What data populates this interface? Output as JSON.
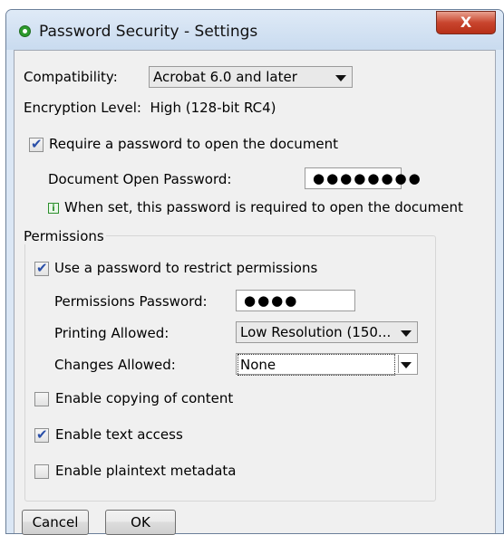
{
  "window": {
    "title": "Password Security - Settings",
    "close_label": "X"
  },
  "compatibility": {
    "label": "Compatibility:",
    "value": "Acrobat 6.0 and later"
  },
  "encryption": {
    "text": "Encryption Level:  High (128-bit RC4)"
  },
  "open_password": {
    "checkbox_label": "Require a password to open the document",
    "checked": true,
    "field_label": "Document Open Password:",
    "field_value": "●●●●●●●●",
    "info_icon": "i",
    "info_text": "When set, this password is required to open the document"
  },
  "permissions": {
    "group_label": "Permissions",
    "checkbox_label": "Use a password to restrict permissions",
    "checked": true,
    "password_label": "Permissions Password:",
    "password_value": "●●●●",
    "printing_label": "Printing Allowed:",
    "printing_value": "Low Resolution (150...",
    "changes_label": "Changes Allowed:",
    "changes_value": "None",
    "options": [
      {
        "label": "Enable copying of content",
        "checked": false
      },
      {
        "label": "Enable text access",
        "checked": true
      },
      {
        "label": "Enable plaintext metadata",
        "checked": false
      }
    ]
  },
  "buttons": {
    "cancel": "Cancel",
    "ok": "OK"
  }
}
